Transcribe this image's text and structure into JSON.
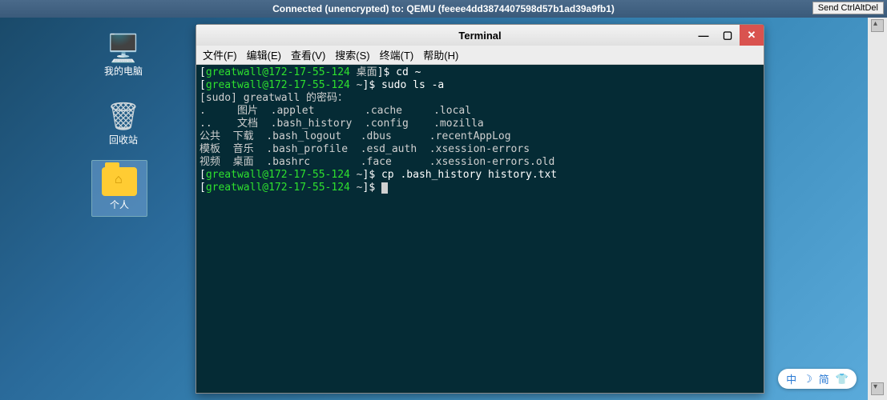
{
  "topbar": {
    "status": "Connected (unencrypted) to: QEMU (feeee4dd3874407598d57b1ad39a9fb1)",
    "button": "Send CtrlAltDel"
  },
  "desktop": {
    "computer_label": "我的电脑",
    "trash_label": "回收站",
    "personal_label": "个人"
  },
  "terminal": {
    "title": "Terminal",
    "menu": {
      "file": "文件(F)",
      "edit": "编辑(E)",
      "view": "查看(V)",
      "search": "搜索(S)",
      "terminal": "终端(T)",
      "help": "帮助(H)"
    },
    "prompt1_user": "greatwall@172-17-55-124",
    "prompt1_loc": "桌面",
    "cmd1": "cd ~",
    "prompt2_user": "greatwall@172-17-55-124",
    "prompt2_loc": "~",
    "cmd2": "sudo ls -a",
    "sudo_line": "[sudo] greatwall 的密码：",
    "ls_lines": [
      ".     图片  .applet        .cache     .local",
      "..    文档  .bash_history  .config    .mozilla",
      "公共  下载  .bash_logout   .dbus      .recentAppLog",
      "模板  音乐  .bash_profile  .esd_auth  .xsession-errors",
      "视频  桌面  .bashrc        .face      .xsession-errors.old"
    ],
    "prompt3_user": "greatwall@172-17-55-124",
    "prompt3_loc": "~",
    "cmd3": "cp .bash_history history.txt",
    "prompt4_user": "greatwall@172-17-55-124",
    "prompt4_loc": "~"
  },
  "ime": {
    "a": "中",
    "b": "☽",
    "c": "简",
    "d": "👕"
  }
}
